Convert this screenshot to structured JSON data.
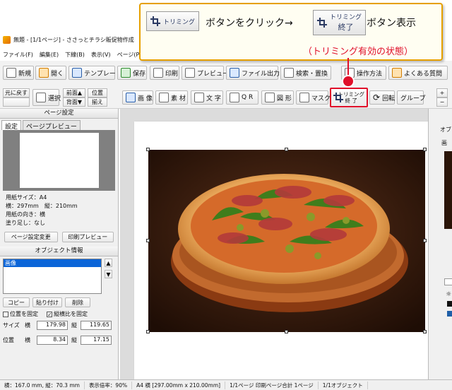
{
  "callout": {
    "trim_button_label": "トリミング",
    "text_click": "ボタンをクリック→",
    "trim_end_label_1": "トリミング",
    "trim_end_label_2": "終了",
    "text_display": "ボタン表示",
    "note": "（トリミング有効の状態）",
    "accent_color": "#e6a000",
    "marker_color": "#e0102a"
  },
  "window": {
    "title": "無題 - [1/1ページ] - ささっとチラシ販促物作成",
    "menus": [
      "ファイル(F)",
      "編集(E)",
      "下線(B)",
      "表示(V)",
      "ページ(P)",
      "デー"
    ]
  },
  "toolbar1": {
    "new": "新規",
    "open": "開く",
    "template": "テンプレート",
    "save": "保存",
    "print": "印刷",
    "preview": "プレビュー",
    "file_output": "ファイル出力",
    "search_replace": "検索・置換",
    "howto": "操作方法",
    "faq": "よくある質問"
  },
  "toolbar2": {
    "undo_1": "元に戻す",
    "undo_2": "やり直す",
    "select": "選択",
    "front": "前面▲",
    "back": "背面▼",
    "align_1": "位置",
    "align_2": "揃え",
    "image": "画 像",
    "material": "素 材",
    "text": "文 字",
    "qr": "Q R",
    "shape": "図 形",
    "mask": "マスク",
    "trim_end_1": "トリミング",
    "trim_end_2": "終 了",
    "rotate": "回転",
    "group": "グループ"
  },
  "page_settings": {
    "header": "ページ設定",
    "tab_settings": "設定",
    "tab_preview": "ページプレビュー",
    "paper_size": "用紙サイズ：A4",
    "dims": "横：297mm　縦：210mm",
    "orientation": "用紙の向き：横",
    "bleed": "塗り足し：なし",
    "change_button": "ページ設定変更",
    "print_preview_button": "印刷プレビュー"
  },
  "object_info": {
    "header": "オブジェクト情報",
    "list_item": "画像",
    "copy": "コピー",
    "paste": "貼り付け",
    "delete": "削除",
    "fix_position": "位置を固定",
    "fix_ratio": "縦横比を固定",
    "size_label": "サイズ",
    "pos_label": "位置",
    "width_label": "横",
    "height_label": "縦",
    "size_w": "179.98",
    "size_h": "119.65",
    "pos_x": "8.34",
    "pos_y": "17.15",
    "fix_position_checked": false,
    "fix_ratio_checked": true
  },
  "right_panel": {
    "header_fragment": "オブ",
    "sub_fragment": "画"
  },
  "status": {
    "dims": "横：167.0 mm, 縦：70.3 mm",
    "zoom": "表示倍率：90%",
    "paper": "A4 横 [297.00mm x 210.00mm]",
    "pages": "1/1ページ 印刷ページ合計 1ページ",
    "objects": "1/1オブジェクト"
  }
}
